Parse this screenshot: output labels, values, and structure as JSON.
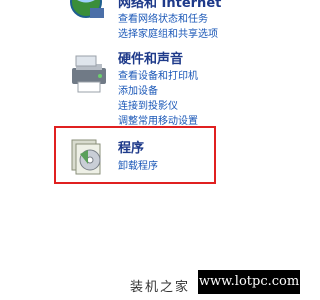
{
  "network": {
    "title": "网络和 Internet",
    "links": [
      "查看网络状态和任务",
      "选择家庭组和共享选项"
    ]
  },
  "hardware": {
    "title": "硬件和声音",
    "links": [
      "查看设备和打印机",
      "添加设备",
      "连接到投影仪",
      "调整常用移动设置"
    ]
  },
  "programs": {
    "title": "程序",
    "links": [
      "卸载程序"
    ]
  },
  "watermark": {
    "site_name": "装机之家",
    "url": "www.lotpc.com"
  },
  "colors": {
    "highlight": "#e02020",
    "title": "#1e3a8a",
    "link": "#1a57b7"
  }
}
